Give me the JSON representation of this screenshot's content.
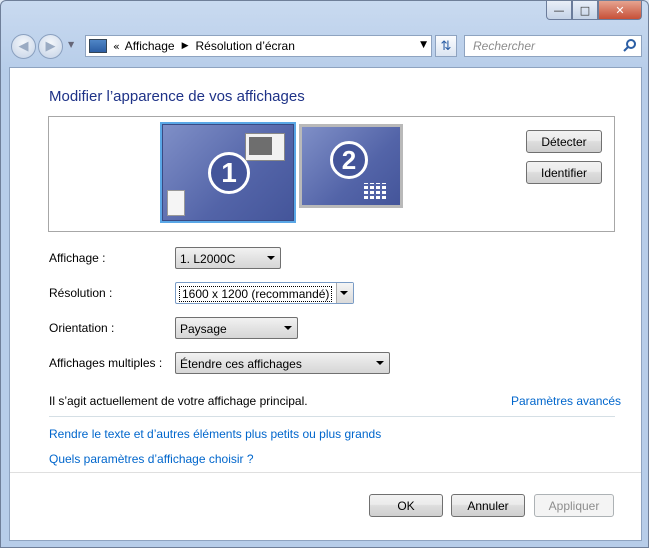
{
  "window": {
    "controls": {
      "minimize": "—",
      "maximize": "□",
      "close": "✕"
    }
  },
  "navigation": {
    "address_prefix": "«",
    "breadcrumbs": [
      "Affichage",
      "Résolution d’écran"
    ],
    "search_placeholder": "Rechercher"
  },
  "page": {
    "title": "Modifier l’apparence de vos affichages",
    "monitors": [
      {
        "number": "1",
        "selected": true
      },
      {
        "number": "2",
        "selected": false
      }
    ],
    "detect_label": "Détecter",
    "identify_label": "Identifier",
    "fields": {
      "display": {
        "label": "Affichage :",
        "value": "1. L2000C"
      },
      "resolution": {
        "label": "Résolution :",
        "value": "1600 x 1200 (recommandé)"
      },
      "orientation": {
        "label": "Orientation :",
        "value": "Paysage"
      },
      "multiple": {
        "label": "Affichages multiples :",
        "value": "Étendre ces affichages"
      }
    },
    "info_text": "Il s’agit actuellement de votre affichage principal.",
    "advanced_link": "Paramètres avancés",
    "links": [
      "Rendre le texte et d’autres éléments plus petits ou plus grands",
      "Quels paramètres d’affichage choisir ?"
    ]
  },
  "footer": {
    "ok_label": "OK",
    "cancel_label": "Annuler",
    "apply_label": "Appliquer"
  },
  "colors": {
    "title_blue": "#1e3287",
    "link_blue": "#0066cc",
    "monitor_fill": "#5364a8",
    "selection_outline": "#5aa7e6"
  }
}
